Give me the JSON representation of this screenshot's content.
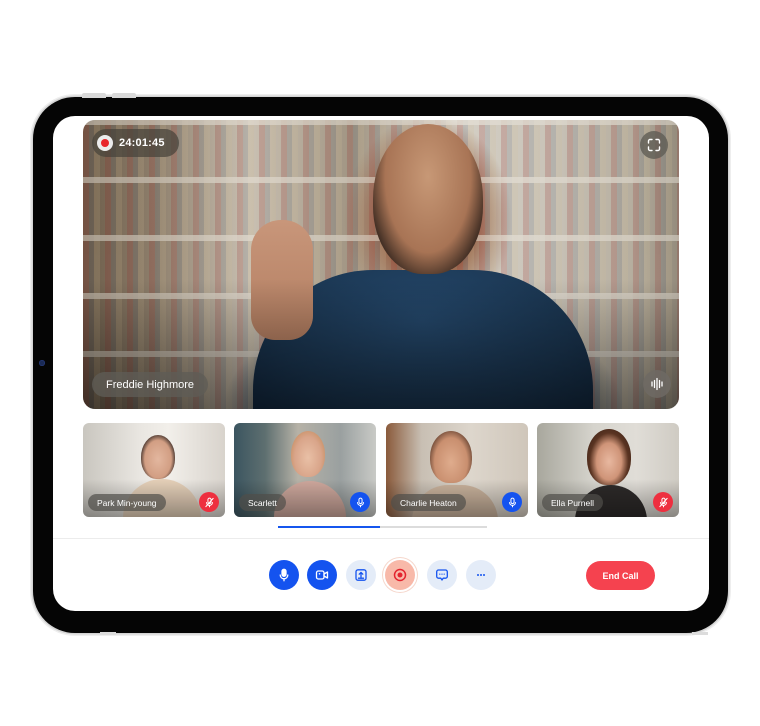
{
  "call": {
    "recording": {
      "active": true,
      "elapsed": "24:01:45"
    },
    "main_speaker": {
      "name": "Freddie Highmore"
    },
    "icons": {
      "fullscreen": "fullscreen-icon",
      "audio_level": "audio-waveform-icon",
      "record_dot": "record-dot-icon"
    }
  },
  "participants": [
    {
      "name": "Park Min-young",
      "mic": "muted",
      "mic_icon": "mic-off-icon"
    },
    {
      "name": "Scarlett",
      "mic": "on",
      "mic_icon": "mic-icon"
    },
    {
      "name": "Charlie Heaton",
      "mic": "on",
      "mic_icon": "mic-icon"
    },
    {
      "name": "Ella Purnell",
      "mic": "muted",
      "mic_icon": "mic-off-icon"
    }
  ],
  "pager": {
    "progress": 0.49
  },
  "controls": {
    "buttons": [
      {
        "id": "mic",
        "icon": "mic-icon",
        "state": "active"
      },
      {
        "id": "camera",
        "icon": "video-camera-icon",
        "state": "active"
      },
      {
        "id": "share",
        "icon": "share-screen-icon",
        "state": "inactive"
      },
      {
        "id": "record",
        "icon": "record-icon",
        "state": "recording"
      },
      {
        "id": "chat",
        "icon": "chat-icon",
        "state": "inactive"
      },
      {
        "id": "more",
        "icon": "more-icon",
        "state": "inactive"
      }
    ],
    "end_call_label": "End Call"
  },
  "colors": {
    "primary": "#1453ef",
    "danger": "#f5424f",
    "muted_badge": "#ee2f3f",
    "soft_button": "#e4ecf8",
    "record_button": "#f8b9a9"
  }
}
